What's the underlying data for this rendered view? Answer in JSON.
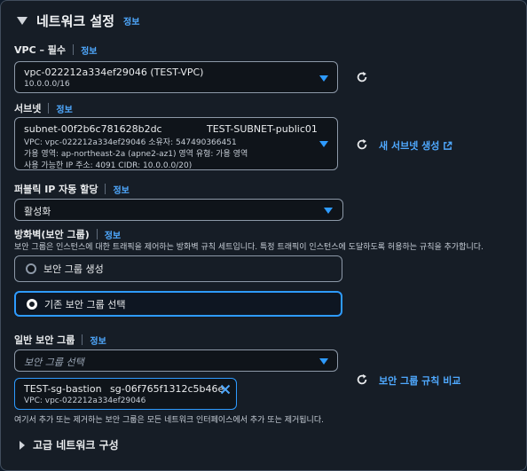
{
  "section": {
    "title": "네트워크 설정",
    "info": "정보"
  },
  "vpc": {
    "label": "VPC – 필수",
    "info": "정보",
    "value": "vpc-022212a334ef29046 (TEST-VPC)",
    "cidr": "10.0.0.0/16"
  },
  "subnet": {
    "label": "서브넷",
    "info": "정보",
    "id": "subnet-00f2b6c781628b2dc",
    "name": "TEST-SUBNET-public01",
    "line1": "VPC: vpc-022212a334ef29046     소유자: 547490366451",
    "line2": "가용 영역: ap-northeast-2a (apne2-az1)     영역 유형: 가용 영역",
    "line3": "사용 가능한 IP 주소: 4091     CIDR: 10.0.0.0/20)",
    "new_link": "새 서브넷 생성"
  },
  "public_ip": {
    "label": "퍼블릭 IP 자동 할당",
    "info": "정보",
    "value": "활성화"
  },
  "firewall": {
    "label": "방화벽(보안 그룹)",
    "info": "정보",
    "description": "보안 그룹은 인스턴스에 대한 트래픽을 제어하는 방화벽 규칙 세트입니다. 특정 트래픽이 인스턴스에 도달하도록 허용하는 규칙을 추가합니다.",
    "option_create": "보안 그룹 생성",
    "option_existing": "기존 보안 그룹 선택",
    "selected": "existing"
  },
  "common_sg": {
    "label": "일반 보안 그룹",
    "info": "정보",
    "placeholder": "보안 그룹 선택",
    "compare_link": "보안 그룹 규칙 비교",
    "token": {
      "name": "TEST-sg-bastion",
      "id": "sg-06f765f1312c5b46e",
      "vpc": "VPC: vpc-022212a334ef29046"
    },
    "hint": "여기서 추가 또는 제거하는 보안 그룹은 모든 네트워크 인터페이스에서 추가 또는 제거됩니다."
  },
  "advanced": {
    "label": "고급 네트워크 구성"
  },
  "colors": {
    "accent": "#2e9bff",
    "link": "#4fa9ff",
    "panel": "#161d26"
  }
}
